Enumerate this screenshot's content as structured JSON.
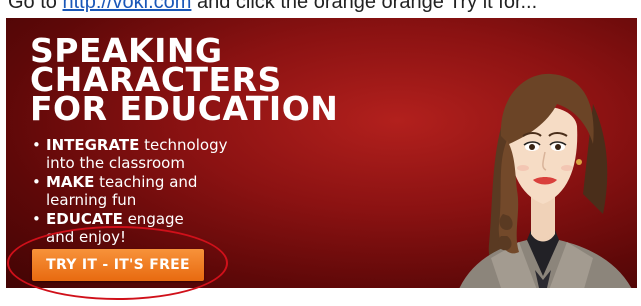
{
  "top": {
    "prefix": "Go to ",
    "link": "http://voki.com",
    "suffix": " and click the orange orange Try it for..."
  },
  "banner": {
    "headline": [
      "SPEAKING",
      "CHARACTERS",
      "FOR EDUCATION"
    ],
    "bullets": [
      {
        "strong": "INTEGRATE",
        "rest": " technology",
        "cont": "into the classroom"
      },
      {
        "strong": "MAKE",
        "rest": " teaching and",
        "cont": "learning fun"
      },
      {
        "strong": "EDUCATE",
        "rest": " engage",
        "cont": "and enjoy!"
      }
    ],
    "cta_label": "TRY IT - IT'S FREE",
    "bullet_glyph": "•"
  },
  "colors": {
    "banner_red": "#8b1212",
    "cta_orange": "#f07d24",
    "annotation_red": "#d0101a",
    "link_blue": "#1a57b8"
  }
}
